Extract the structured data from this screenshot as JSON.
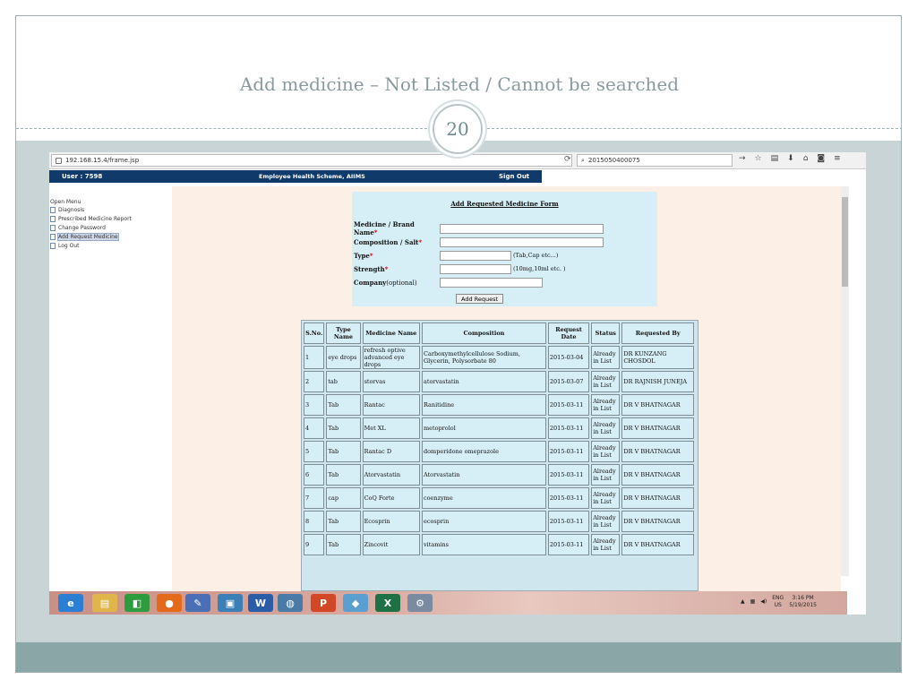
{
  "slide": {
    "title": "Add medicine – Not Listed / Cannot be searched",
    "page_number": "20"
  },
  "browser": {
    "url": "192.168.15.4/frame.jsp",
    "search_value": "2015050400075",
    "reload_icon": "reload-icon"
  },
  "app_header": {
    "user": "User : 7598",
    "title": "Employee Health Scheme, AIIMS",
    "sign_out": "Sign Out"
  },
  "menu": {
    "heading": "Open Menu",
    "items": [
      {
        "label": "Diagnosis"
      },
      {
        "label": "Prescribed Medicine Report"
      },
      {
        "label": "Change Password"
      },
      {
        "label": "Add Request Medicine"
      },
      {
        "label": "Log Out"
      }
    ]
  },
  "form": {
    "title": "Add Requested Medicine Form",
    "fields": [
      {
        "label": "Medicine / Brand Name",
        "required": "*",
        "optional": "",
        "hint": ""
      },
      {
        "label": "Composition / Salt",
        "required": "*",
        "optional": "",
        "hint": ""
      },
      {
        "label": "Type",
        "required": "*",
        "optional": "",
        "hint": "(Tab,Cap etc...)"
      },
      {
        "label": "Strength",
        "required": "*",
        "optional": "",
        "hint": "(10mg,10ml etc. )"
      },
      {
        "label": "Company",
        "required": "",
        "optional": "(optional)",
        "hint": ""
      }
    ],
    "submit": "Add Request"
  },
  "table": {
    "headers": [
      "S.No.",
      "Type Name",
      "Medicine Name",
      "Composition",
      "Request Date",
      "Status",
      "Requested By"
    ],
    "rows": [
      [
        "1",
        "eye drops",
        "refresh optive advanced eye drops",
        "Carboxymethylcellulose Sodium, Glycerin, Polysorbate 80",
        "2015-03-04",
        "Already in List",
        "DR KUNZANG CHOSDOL"
      ],
      [
        "2",
        "tab",
        "storvas",
        "atorvastatin",
        "2015-03-07",
        "Already in List",
        "DR RAJNISH JUNEJA"
      ],
      [
        "3",
        "Tab",
        "Rantac",
        "Ranitidine",
        "2015-03-11",
        "Already in List",
        "DR V BHATNAGAR"
      ],
      [
        "4",
        "Tab",
        "Met XL",
        "metoprolol",
        "2015-03-11",
        "Already in List",
        "DR V BHATNAGAR"
      ],
      [
        "5",
        "Tab",
        "Rantac D",
        "domperidone omeprazole",
        "2015-03-11",
        "Already in List",
        "DR V BHATNAGAR"
      ],
      [
        "6",
        "Tab",
        "Atorvastatin",
        "Atorvastatin",
        "2015-03-11",
        "Already in List",
        "DR V BHATNAGAR"
      ],
      [
        "7",
        "cap",
        "CoQ Forte",
        "coenzyme",
        "2015-03-11",
        "Already in List",
        "DR V BHATNAGAR"
      ],
      [
        "8",
        "Tab",
        "Ecosprin",
        "ecosprin",
        "2015-03-11",
        "Already in List",
        "DR V BHATNAGAR"
      ],
      [
        "9",
        "Tab",
        "Zincovit",
        "vitamins",
        "2015-03-11",
        "Already in List",
        "DR V BHATNAGAR"
      ]
    ]
  },
  "taskbar": {
    "apps": [
      {
        "icon": "internet-explorer-icon",
        "glyph": "e",
        "color": "#2a7fd4"
      },
      {
        "icon": "file-explorer-icon",
        "glyph": "▤",
        "color": "#e0b64a"
      },
      {
        "icon": "store-icon",
        "glyph": "◧",
        "color": "#2e9b3e"
      },
      {
        "icon": "firefox-icon",
        "glyph": "●",
        "color": "#e36a1b"
      },
      {
        "icon": "paint-icon",
        "glyph": "✎",
        "color": "#4a6fb5"
      },
      {
        "icon": "remote-desktop-icon",
        "glyph": "▣",
        "color": "#3a7fb5"
      },
      {
        "icon": "word-icon",
        "glyph": "W",
        "color": "#2b5ca8"
      },
      {
        "icon": "database-icon",
        "glyph": "◍",
        "color": "#4a7aa6"
      },
      {
        "icon": "powerpoint-icon",
        "glyph": "P",
        "color": "#d24726"
      },
      {
        "icon": "app-icon",
        "glyph": "◆",
        "color": "#5a9fcf"
      },
      {
        "icon": "excel-icon",
        "glyph": "X",
        "color": "#1e7145"
      },
      {
        "icon": "tools-icon",
        "glyph": "⚙",
        "color": "#7a8aa0"
      }
    ],
    "lang": "ENG",
    "region": "US",
    "time": "3:16 PM",
    "date": "5/19/2015"
  }
}
